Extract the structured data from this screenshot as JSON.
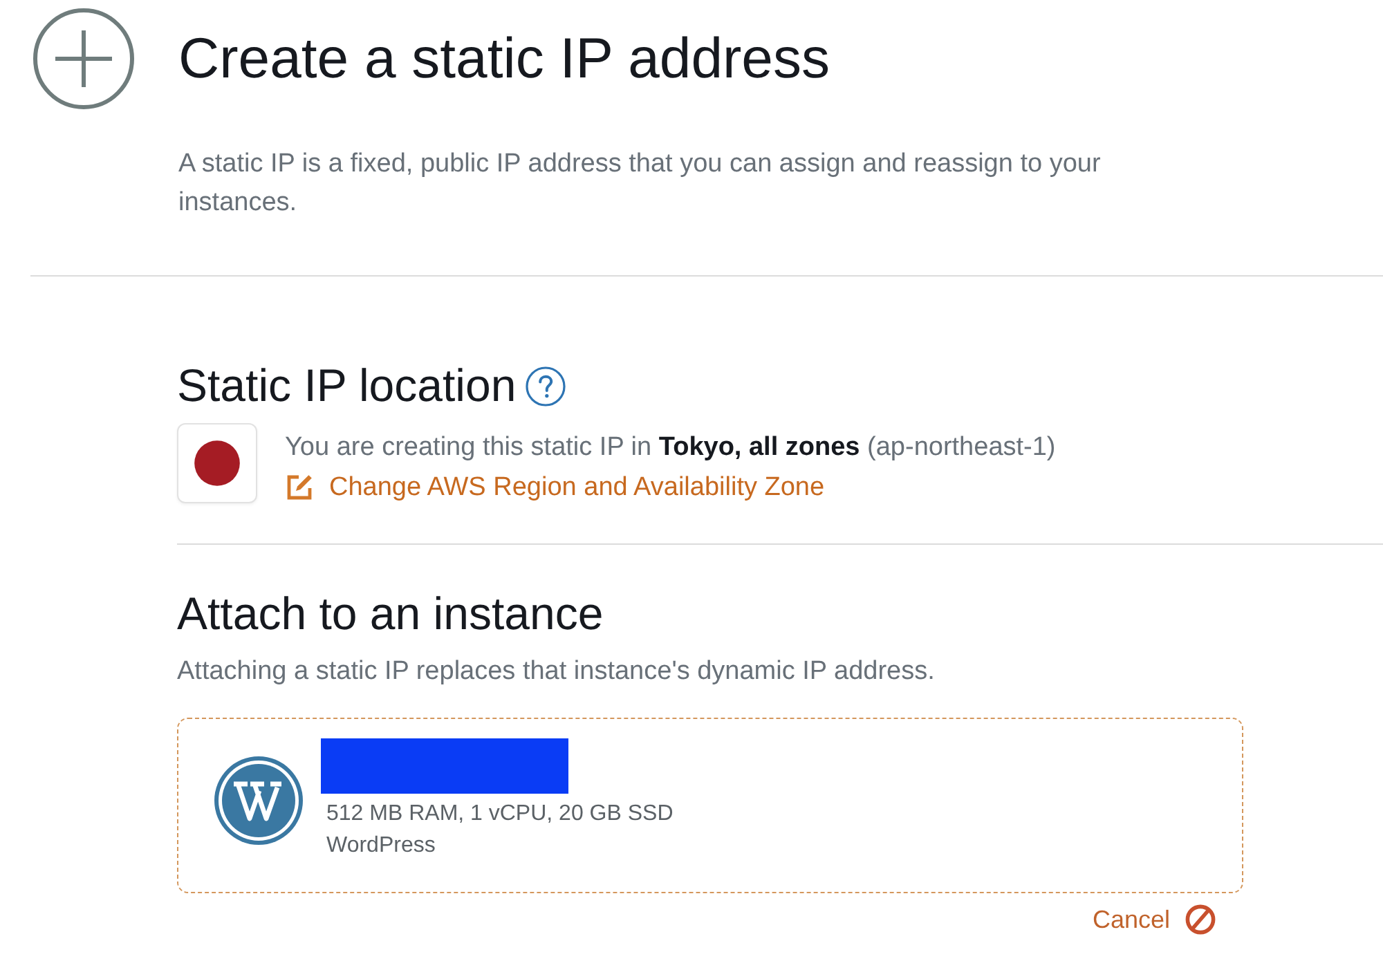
{
  "header": {
    "title": "Create a static IP address",
    "description": "A static IP is a fixed, public IP address that you can assign and reassign to your instances."
  },
  "location": {
    "heading": "Static IP location",
    "region_text": "You are creating this static IP in **Tokyo, all zones** (ap-northeast-1)",
    "change_link": "Change AWS Region and Availability Zone"
  },
  "attach": {
    "heading": "Attach to an instance",
    "description": "Attaching a static IP replaces that instance's dynamic IP address.",
    "instance": {
      "specs": "512 MB RAM, 1 vCPU, 20 GB SSD",
      "blueprint": "WordPress"
    },
    "cancel": "Cancel"
  }
}
